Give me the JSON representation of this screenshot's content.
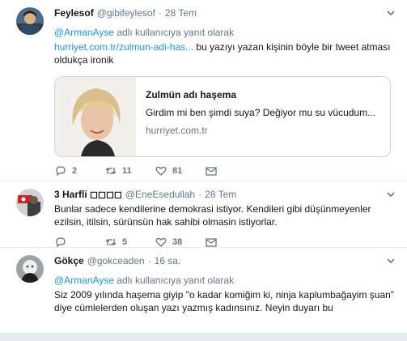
{
  "tweets": [
    {
      "fullname": "Feylesof",
      "username": "@gibifeylesof",
      "time": "28 Tem",
      "reply_prefix": "",
      "reply_mention": "@ArmanAyse",
      "reply_suffix": " adlı kullanıcıya yanıt olarak",
      "link": "hurriyet.com.tr/zulmun-adi-has...",
      "text": " bu yazıyı yazan kişinin böyle bir tweet atması oldukça ironik",
      "card": {
        "title": "Zulmün adı haşema",
        "description": "Girdim mi ben şimdi suya? Değiyor mu su vücudum...",
        "domain": "hurriyet.com.tr"
      },
      "actions": {
        "replies": "2",
        "retweets": "11",
        "likes": "81"
      }
    },
    {
      "fullname": "3 Harfli ◻◻◻◻",
      "username": "@EneEsedullah",
      "time": "28 Tem",
      "text": "Bunlar sadece kendilerine demokrasi istiyor. Kendileri gibi düşünmeyenler ezilsin, itilsin, sürünsün hak sahibi olmasin istiyorlar.",
      "actions": {
        "replies": "",
        "retweets": "5",
        "likes": "38"
      }
    },
    {
      "fullname": "Gökçe",
      "username": "@gokceaden",
      "time": "16 sa.",
      "reply_mention": "@ArmanAyse",
      "reply_suffix": " adlı kullanıcıya yanıt olarak",
      "text": "Siz 2009 yılında haşema giyip \"o kadar komiğim ki, ninja kaplumbağayim şuan\" diye cümlelerden oluşan yazı yazmış kadınsınız. Neyin duyarı bu"
    }
  ],
  "separator": "·",
  "colors": {
    "link": "#1b95e0",
    "secondary": "#657786",
    "border": "#e6ecf0"
  },
  "icons": [
    "caret-down-icon",
    "reply-icon",
    "retweet-icon",
    "like-icon",
    "direct-message-icon"
  ]
}
